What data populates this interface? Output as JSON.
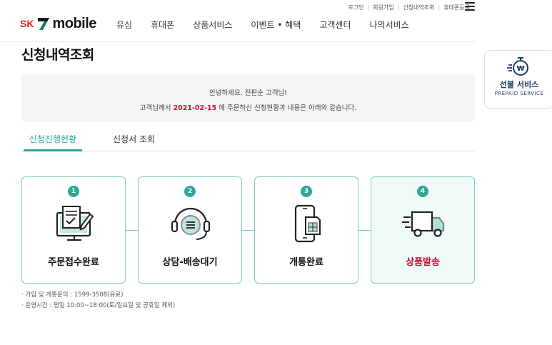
{
  "util_links": [
    "로그인",
    "회원가입",
    "신청내역조회",
    "휴대폰등록"
  ],
  "logo": {
    "sk": "SK",
    "mobile": "mobile"
  },
  "gnb": [
    "유심",
    "휴대폰",
    "상품서비스",
    "이벤트 • 혜택",
    "고객센터",
    "나의서비스"
  ],
  "page_title": "신청내역조회",
  "greeting": {
    "line1": "안녕하세요. 전판순 고객님!",
    "line2_before": "고객님께서 ",
    "date": "2021-02-15",
    "line2_after": " 에 주문하신 신청현황과 내용은 아래와 같습니다."
  },
  "tabs": {
    "progress": "신청진행현황",
    "lookup": "신청서 조회"
  },
  "steps": [
    {
      "num": "1",
      "label": "주문접수완료",
      "icon": "order-monitor-icon"
    },
    {
      "num": "2",
      "label": "상담-배송대기",
      "icon": "headset-chat-icon"
    },
    {
      "num": "3",
      "label": "개통완료",
      "icon": "phone-sim-icon"
    },
    {
      "num": "4",
      "label": "상품발송",
      "icon": "delivery-truck-icon"
    }
  ],
  "active_step": 4,
  "notes": [
    "· 가입 및 개통문의 : 1599-3508(유료)",
    "· 운영시간 : 평일 10:00~18:00(토/일요일 및 공휴일 제외)"
  ],
  "prepaid": {
    "title": "선불 서비스",
    "subtitle": "PREPAID SERVICE"
  },
  "colors": {
    "accent": "#2ba89a",
    "highlight": "#c8102e",
    "brand_red": "#e2231a",
    "navy": "#1a3b6e"
  }
}
